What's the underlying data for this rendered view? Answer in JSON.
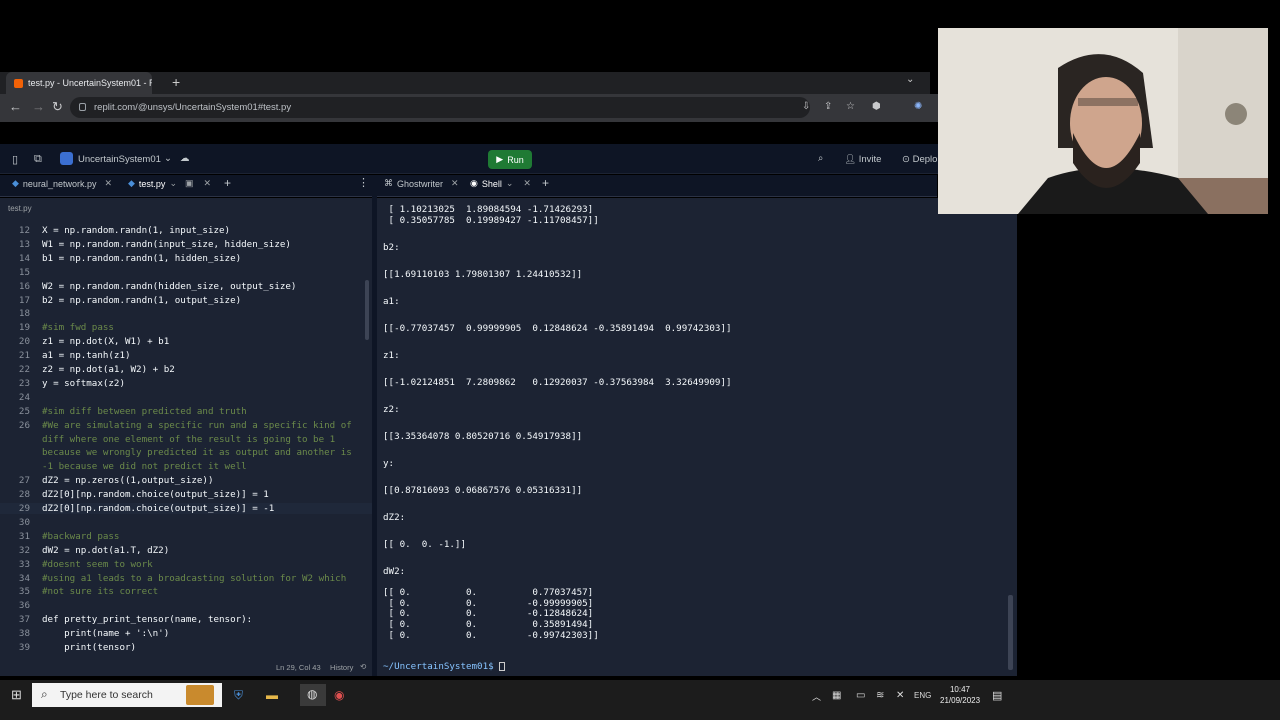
{
  "browser": {
    "tab_title": "test.py - UncertainSystem01 - Re",
    "url": "replit.com/@unsys/UncertainSystem01#test.py"
  },
  "replit": {
    "project_name": "UncertainSystem01",
    "run_label": "Run",
    "invite_label": "Invite",
    "deploy_label": "Deplo",
    "editor_tabs": [
      "neural_network.py",
      "test.py"
    ],
    "breadcrumb": "test.py",
    "shell_tabs": [
      "Ghostwriter",
      "Shell"
    ],
    "status": {
      "position": "Ln 29, Col 43",
      "history": "History"
    }
  },
  "code_lines": [
    {
      "n": "12",
      "t": "X = np.random.randn(1, input_size)"
    },
    {
      "n": "13",
      "t": "W1 = np.random.randn(input_size, hidden_size)"
    },
    {
      "n": "14",
      "t": "b1 = np.random.randn(1, hidden_size)"
    },
    {
      "n": "15",
      "t": ""
    },
    {
      "n": "16",
      "t": "W2 = np.random.randn(hidden_size, output_size)"
    },
    {
      "n": "17",
      "t": "b2 = np.random.randn(1, output_size)"
    },
    {
      "n": "18",
      "t": ""
    },
    {
      "n": "19",
      "t": "#sim fwd pass"
    },
    {
      "n": "20",
      "t": "z1 = np.dot(X, W1) + b1"
    },
    {
      "n": "21",
      "t": "a1 = np.tanh(z1)"
    },
    {
      "n": "22",
      "t": "z2 = np.dot(a1, W2) + b2"
    },
    {
      "n": "23",
      "t": "y = softmax(z2)"
    },
    {
      "n": "24",
      "t": ""
    },
    {
      "n": "25",
      "t": "#sim diff between predicted and truth"
    },
    {
      "n": "26",
      "t": "#We are simulating a specific run and a specific kind of"
    },
    {
      "n": "",
      "t": "diff where one element of the result is going to be 1"
    },
    {
      "n": "",
      "t": "because we wrongly predicted it as output and another is"
    },
    {
      "n": "",
      "t": "-1 because we did not predict it well"
    },
    {
      "n": "27",
      "t": "dZ2 = np.zeros((1,output_size))"
    },
    {
      "n": "28",
      "t": "dZ2[0][np.random.choice(output_size)] = 1"
    },
    {
      "n": "29",
      "t": "dZ2[0][np.random.choice(output_size)] = -1"
    },
    {
      "n": "30",
      "t": ""
    },
    {
      "n": "31",
      "t": "#backward pass"
    },
    {
      "n": "32",
      "t": "dW2 = np.dot(a1.T, dZ2)"
    },
    {
      "n": "33",
      "t": "#doesnt seem to work"
    },
    {
      "n": "34",
      "t": "#using a1 leads to a broadcasting solution for W2 which"
    },
    {
      "n": "35",
      "t": "#not sure its correct"
    },
    {
      "n": "36",
      "t": ""
    },
    {
      "n": "37",
      "t": "def pretty_print_tensor(name, tensor):"
    },
    {
      "n": "38",
      "t": "    print(name + ':\\n')"
    },
    {
      "n": "39",
      "t": "    print(tensor)"
    }
  ],
  "shell_lines": [
    " [ 1.10213025  1.89084594 -1.71426293]",
    " [ 0.35057785  0.19989427 -1.11708457]]",
    "",
    "b2:",
    "",
    "[[1.69110103 1.79801307 1.24410532]]",
    "",
    "a1:",
    "",
    "[[-0.77037457  0.99999905  0.12848624 -0.35891494  0.99742303]]",
    "",
    "z1:",
    "",
    "[[-1.02124851  7.2809862   0.12920037 -0.37563984  3.32649909]]",
    "",
    "z2:",
    "",
    "[[3.35364078 0.80520716 0.54917938]]",
    "",
    "y:",
    "",
    "[[0.87816093 0.06867576 0.05316331]]",
    "",
    "dZ2:",
    "",
    "[[ 0.  0. -1.]]",
    "",
    "dW2:",
    "",
    "[[ 0.          0.          0.77037457]",
    " [ 0.          0.         -0.99999905]",
    " [ 0.          0.         -0.12848624]",
    " [ 0.          0.          0.35891494]",
    " [ 0.          0.         -0.99742303]]"
  ],
  "shell_prompt": "~/UncertainSystem01$",
  "taskbar": {
    "search_placeholder": "Type here to search",
    "lang": "ENG",
    "time": "10:47",
    "date": "21/09/2023"
  },
  "colors": {
    "run_green": "#1f7a34",
    "editor_bg": "#1c2333",
    "comment": "#6b8a4a"
  }
}
